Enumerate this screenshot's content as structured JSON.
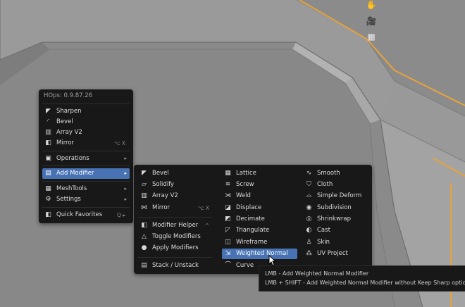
{
  "viewport_tools": {
    "pan": "pan-hand-icon",
    "camera": "camera-icon",
    "grid": "grid-icon"
  },
  "hops_menu": {
    "title": "HOps: 0.9.87.26",
    "items": [
      {
        "label": "Sharpen",
        "icon": "sharpen-icon"
      },
      {
        "label": "Bevel",
        "icon": "bevel-icon"
      },
      {
        "label": "Array V2",
        "icon": "array-icon"
      },
      {
        "label": "Mirror",
        "icon": "mirror-icon",
        "shortcut": "⌥ X"
      },
      {
        "label": "Operations",
        "icon": "operations-icon",
        "submenu": true
      },
      {
        "label": "Add Modifier",
        "icon": "add-modifier-icon",
        "submenu": true,
        "active": true
      },
      {
        "label": "MeshTools",
        "icon": "meshtools-icon",
        "submenu": true
      },
      {
        "label": "Settings",
        "icon": "settings-icon",
        "submenu": true
      },
      {
        "label": "Quick Favorites",
        "icon": "favorites-icon",
        "shortcut": "Q"
      }
    ]
  },
  "modifier_menu": {
    "col1": [
      {
        "label": "Bevel",
        "icon": "bevel-icon"
      },
      {
        "label": "Solidify",
        "icon": "solidify-icon"
      },
      {
        "label": "Array V2",
        "icon": "array-icon"
      },
      {
        "label": "Mirror",
        "icon": "mirror-icon",
        "shortcut": "⌥ X"
      },
      {
        "label": "Modifier Helper",
        "icon": "helper-icon",
        "shortcut": "^"
      },
      {
        "label": "Toggle Modifiers",
        "icon": "triangle-icon"
      },
      {
        "label": "Apply Modifiers",
        "icon": "dot-icon"
      },
      {
        "label": "Stack / Unstack",
        "icon": "stack-icon"
      }
    ],
    "col2": [
      {
        "label": "Lattice",
        "icon": "lattice-icon"
      },
      {
        "label": "Screw",
        "icon": "screw-icon"
      },
      {
        "label": "Weld",
        "icon": "weld-icon"
      },
      {
        "label": "Displace",
        "icon": "displace-icon"
      },
      {
        "label": "Decimate",
        "icon": "decimate-icon"
      },
      {
        "label": "Triangulate",
        "icon": "triangulate-icon"
      },
      {
        "label": "Wireframe",
        "icon": "wireframe-icon"
      },
      {
        "label": "Weighted Normal",
        "icon": "weighted-normal-icon",
        "active": true
      },
      {
        "label": "Curve",
        "icon": "curve-icon"
      }
    ],
    "col3": [
      {
        "label": "Smooth",
        "icon": "smooth-icon"
      },
      {
        "label": "Cloth",
        "icon": "cloth-icon"
      },
      {
        "label": "Simple Deform",
        "icon": "simple-deform-icon"
      },
      {
        "label": "Subdivision",
        "icon": "subdivision-icon"
      },
      {
        "label": "Shrinkwrap",
        "icon": "shrinkwrap-icon"
      },
      {
        "label": "Cast",
        "icon": "cast-icon"
      },
      {
        "label": "Skin",
        "icon": "skin-icon"
      },
      {
        "label": "UV Project",
        "icon": "uv-project-icon"
      }
    ]
  },
  "tooltip": {
    "line1": "LMB - Add Weighted Normal Modifier",
    "line2": "LMB + SHIFT - Add Weighted Normal Modifier without Keep Sharp option"
  },
  "colors": {
    "accent": "#4772b3",
    "menu_bg": "#181818",
    "selection_outline": "#e8a33a"
  }
}
